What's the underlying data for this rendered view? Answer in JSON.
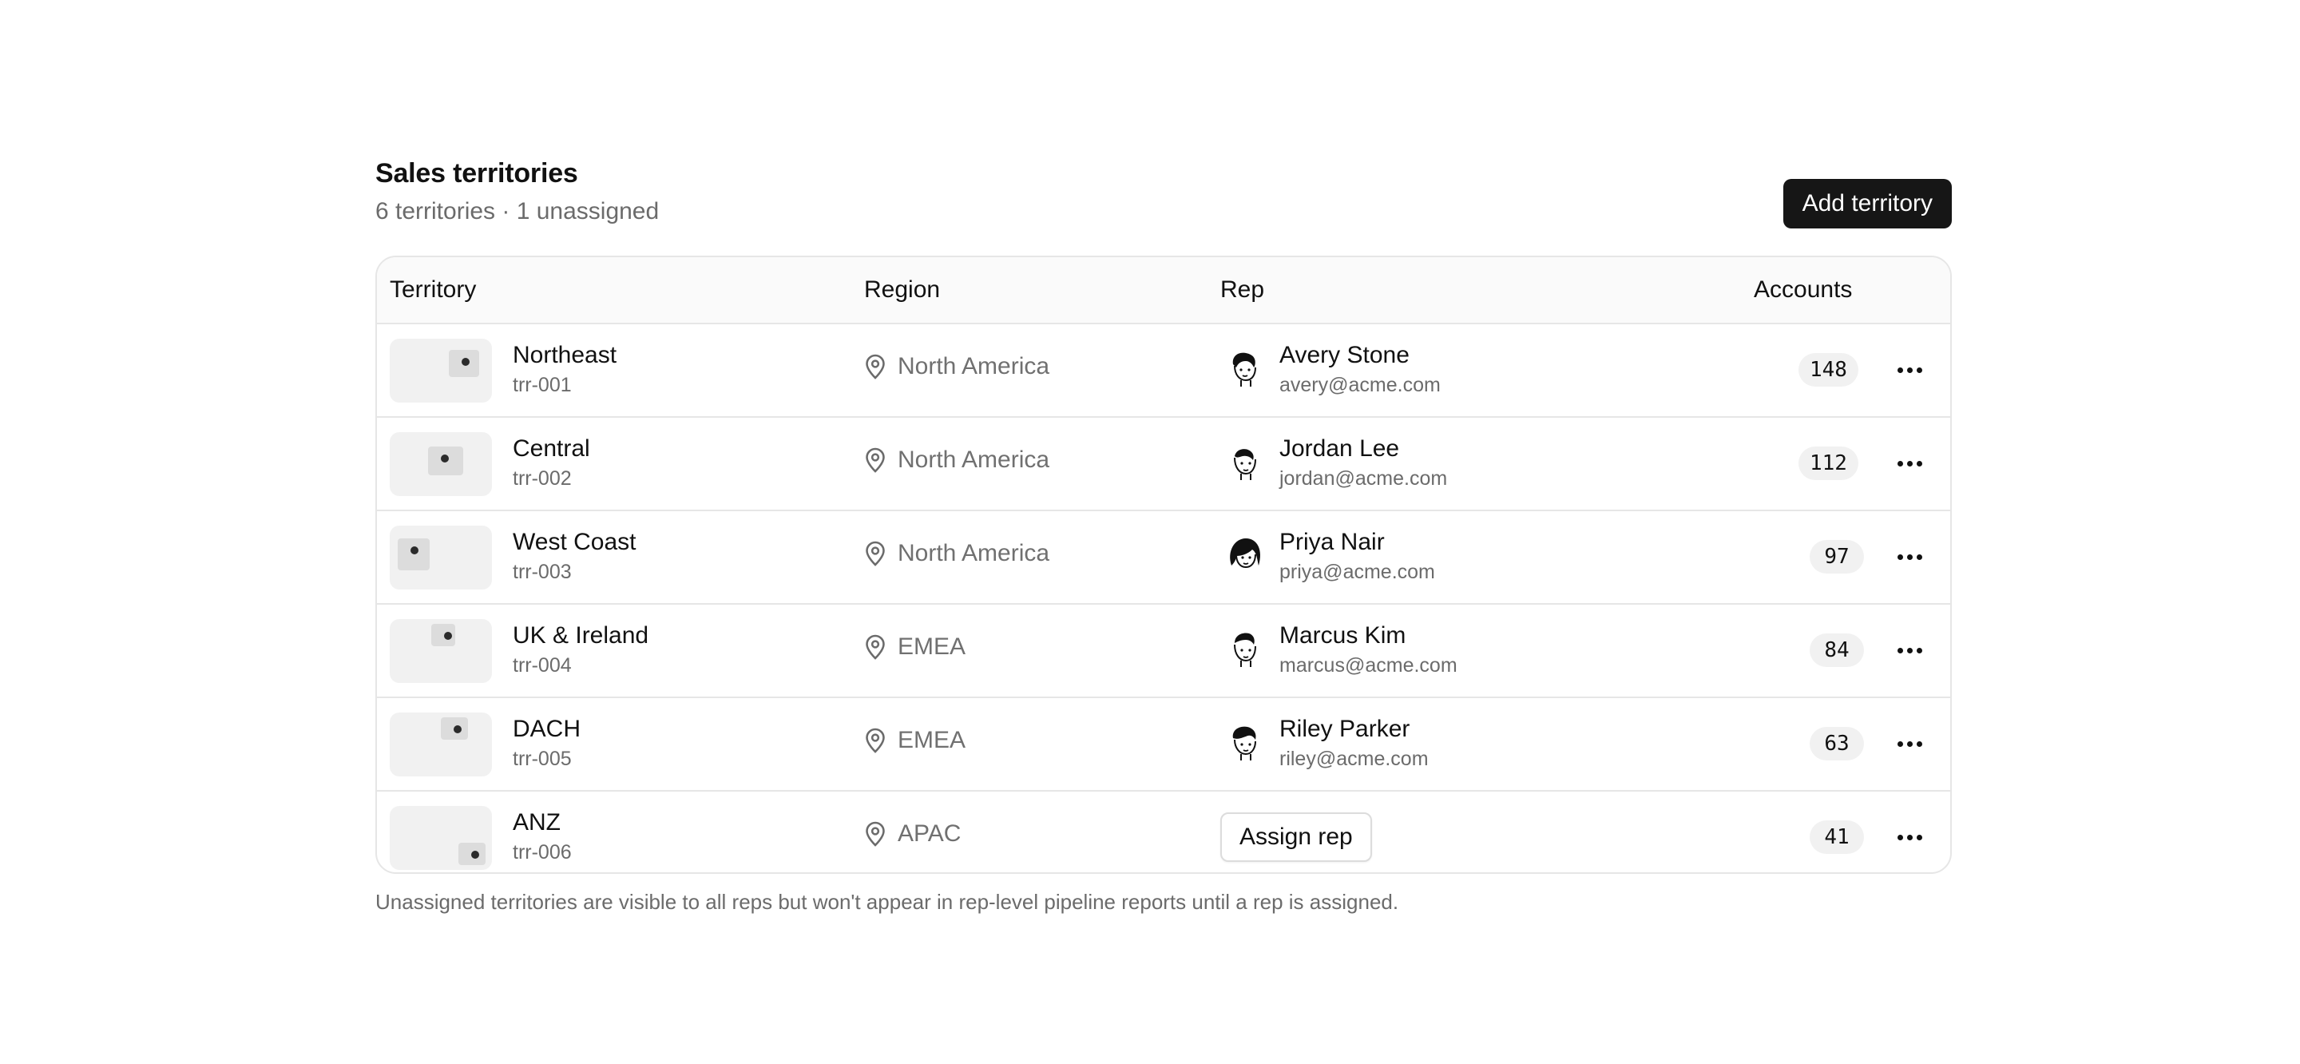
{
  "header": {
    "title": "Sales territories",
    "subtitle": "6 territories · 1 unassigned",
    "add_label": "Add territory"
  },
  "table": {
    "columns": {
      "territory": "Territory",
      "region": "Region",
      "rep": "Rep",
      "accounts": "Accounts"
    },
    "rows": [
      {
        "name": "Northeast",
        "code": "trr-001",
        "region": "North America",
        "rep_name": "Avery Stone",
        "rep_email": "avery@acme.com",
        "accounts": "148",
        "map_icon": "map-thumbnail-icon",
        "avatar_icon": "avatar-illustration-icon"
      },
      {
        "name": "Central",
        "code": "trr-002",
        "region": "North America",
        "rep_name": "Jordan Lee",
        "rep_email": "jordan@acme.com",
        "accounts": "112",
        "map_icon": "map-thumbnail-icon",
        "avatar_icon": "avatar-illustration-icon"
      },
      {
        "name": "West Coast",
        "code": "trr-003",
        "region": "North America",
        "rep_name": "Priya Nair",
        "rep_email": "priya@acme.com",
        "accounts": "97",
        "map_icon": "map-thumbnail-icon",
        "avatar_icon": "avatar-illustration-icon"
      },
      {
        "name": "UK & Ireland",
        "code": "trr-004",
        "region": "EMEA",
        "rep_name": "Marcus Kim",
        "rep_email": "marcus@acme.com",
        "accounts": "84",
        "map_icon": "map-thumbnail-icon",
        "avatar_icon": "avatar-illustration-icon"
      },
      {
        "name": "DACH",
        "code": "trr-005",
        "region": "EMEA",
        "rep_name": "Riley Parker",
        "rep_email": "riley@acme.com",
        "accounts": "63",
        "map_icon": "map-thumbnail-icon",
        "avatar_icon": "avatar-illustration-icon"
      },
      {
        "name": "ANZ",
        "code": "trr-006",
        "region": "APAC",
        "accounts": "41",
        "assign_label": "Assign rep",
        "map_icon": "map-thumbnail-icon"
      }
    ]
  },
  "footnote": "Unassigned territories are visible to all reps but won't appear in rep-level pipeline reports until a rep is assigned.",
  "colors": {
    "primary_button": "#161616",
    "badge_bg": "#f1f1f1",
    "border": "#e6e6e6",
    "muted_text": "#6b6b6b"
  }
}
